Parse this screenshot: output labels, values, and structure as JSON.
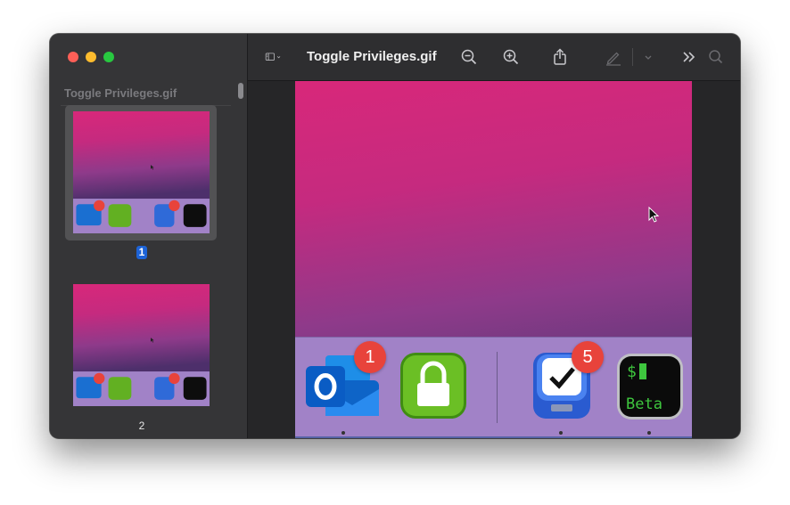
{
  "window": {
    "title": "Toggle Privileges.gif"
  },
  "sidebar": {
    "title": "Toggle Privileges.gif",
    "thumbnails": [
      {
        "page": "1",
        "selected": true
      },
      {
        "page": "2",
        "selected": false
      }
    ]
  },
  "toolbar": {
    "sidebar_toggle_icon": "sidebar-icon",
    "zoom_out_icon": "zoom-out-icon",
    "zoom_in_icon": "zoom-in-icon",
    "share_icon": "share-icon",
    "markup_icon": "pencil-icon",
    "more_icon": "chevrons-right-icon",
    "search_icon": "search-icon"
  },
  "dock": {
    "apps": [
      {
        "name": "outlook",
        "badge": "1"
      },
      {
        "name": "privileges",
        "badge": ""
      },
      {
        "name": "things",
        "badge": "5"
      },
      {
        "name": "terminal-beta",
        "badge": ""
      }
    ],
    "terminal_prompt": "$",
    "terminal_label": "Beta"
  },
  "colors": {
    "accent": "#1d63d6",
    "badge": "#e8433b"
  }
}
